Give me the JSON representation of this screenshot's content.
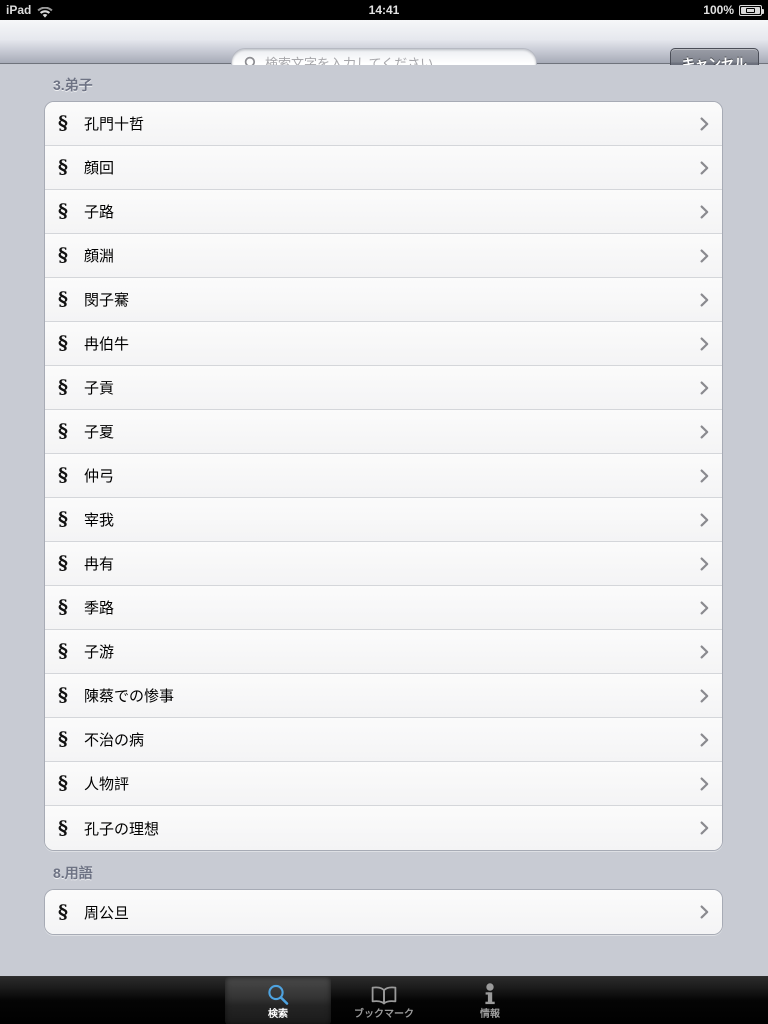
{
  "status_bar": {
    "carrier": "iPad",
    "wifi_icon": "wifi-icon",
    "time": "14:41",
    "battery_percent": "100%",
    "battery_icon": "battery-charging-icon"
  },
  "search_bar": {
    "placeholder": "検索文字を入力してください",
    "value": "",
    "search_icon": "search-icon",
    "cancel_label": "キャンセル"
  },
  "list": {
    "sections": [
      {
        "header": "3.弟子",
        "rows": [
          {
            "mark": "§",
            "label": "孔門十哲"
          },
          {
            "mark": "§",
            "label": "顔回"
          },
          {
            "mark": "§",
            "label": "子路"
          },
          {
            "mark": "§",
            "label": "顔淵"
          },
          {
            "mark": "§",
            "label": "閔子騫"
          },
          {
            "mark": "§",
            "label": "冉伯牛"
          },
          {
            "mark": "§",
            "label": "子貢"
          },
          {
            "mark": "§",
            "label": "子夏"
          },
          {
            "mark": "§",
            "label": "仲弓"
          },
          {
            "mark": "§",
            "label": "宰我"
          },
          {
            "mark": "§",
            "label": "冉有"
          },
          {
            "mark": "§",
            "label": "季路"
          },
          {
            "mark": "§",
            "label": "子游"
          },
          {
            "mark": "§",
            "label": "陳蔡での惨事"
          },
          {
            "mark": "§",
            "label": "不治の病"
          },
          {
            "mark": "§",
            "label": "人物評"
          },
          {
            "mark": "§",
            "label": "孔子の理想"
          }
        ]
      },
      {
        "header": "8.用語",
        "rows": [
          {
            "mark": "§",
            "label": "周公旦"
          }
        ]
      }
    ],
    "disclosure_icon": "chevron-right-icon"
  },
  "tab_bar": {
    "tabs": [
      {
        "label": "検索",
        "icon": "magnifier-icon",
        "selected": true
      },
      {
        "label": "ブックマーク",
        "icon": "book-icon",
        "selected": false
      },
      {
        "label": "情報",
        "icon": "info-person-icon",
        "selected": false
      }
    ]
  },
  "colors": {
    "background": "#c8cbd3",
    "row_background": "#f7f7f7",
    "section_header_text": "#6e7384",
    "accent_selected_tab": "#4ea3e0",
    "tab_bar_background": "#000000"
  }
}
